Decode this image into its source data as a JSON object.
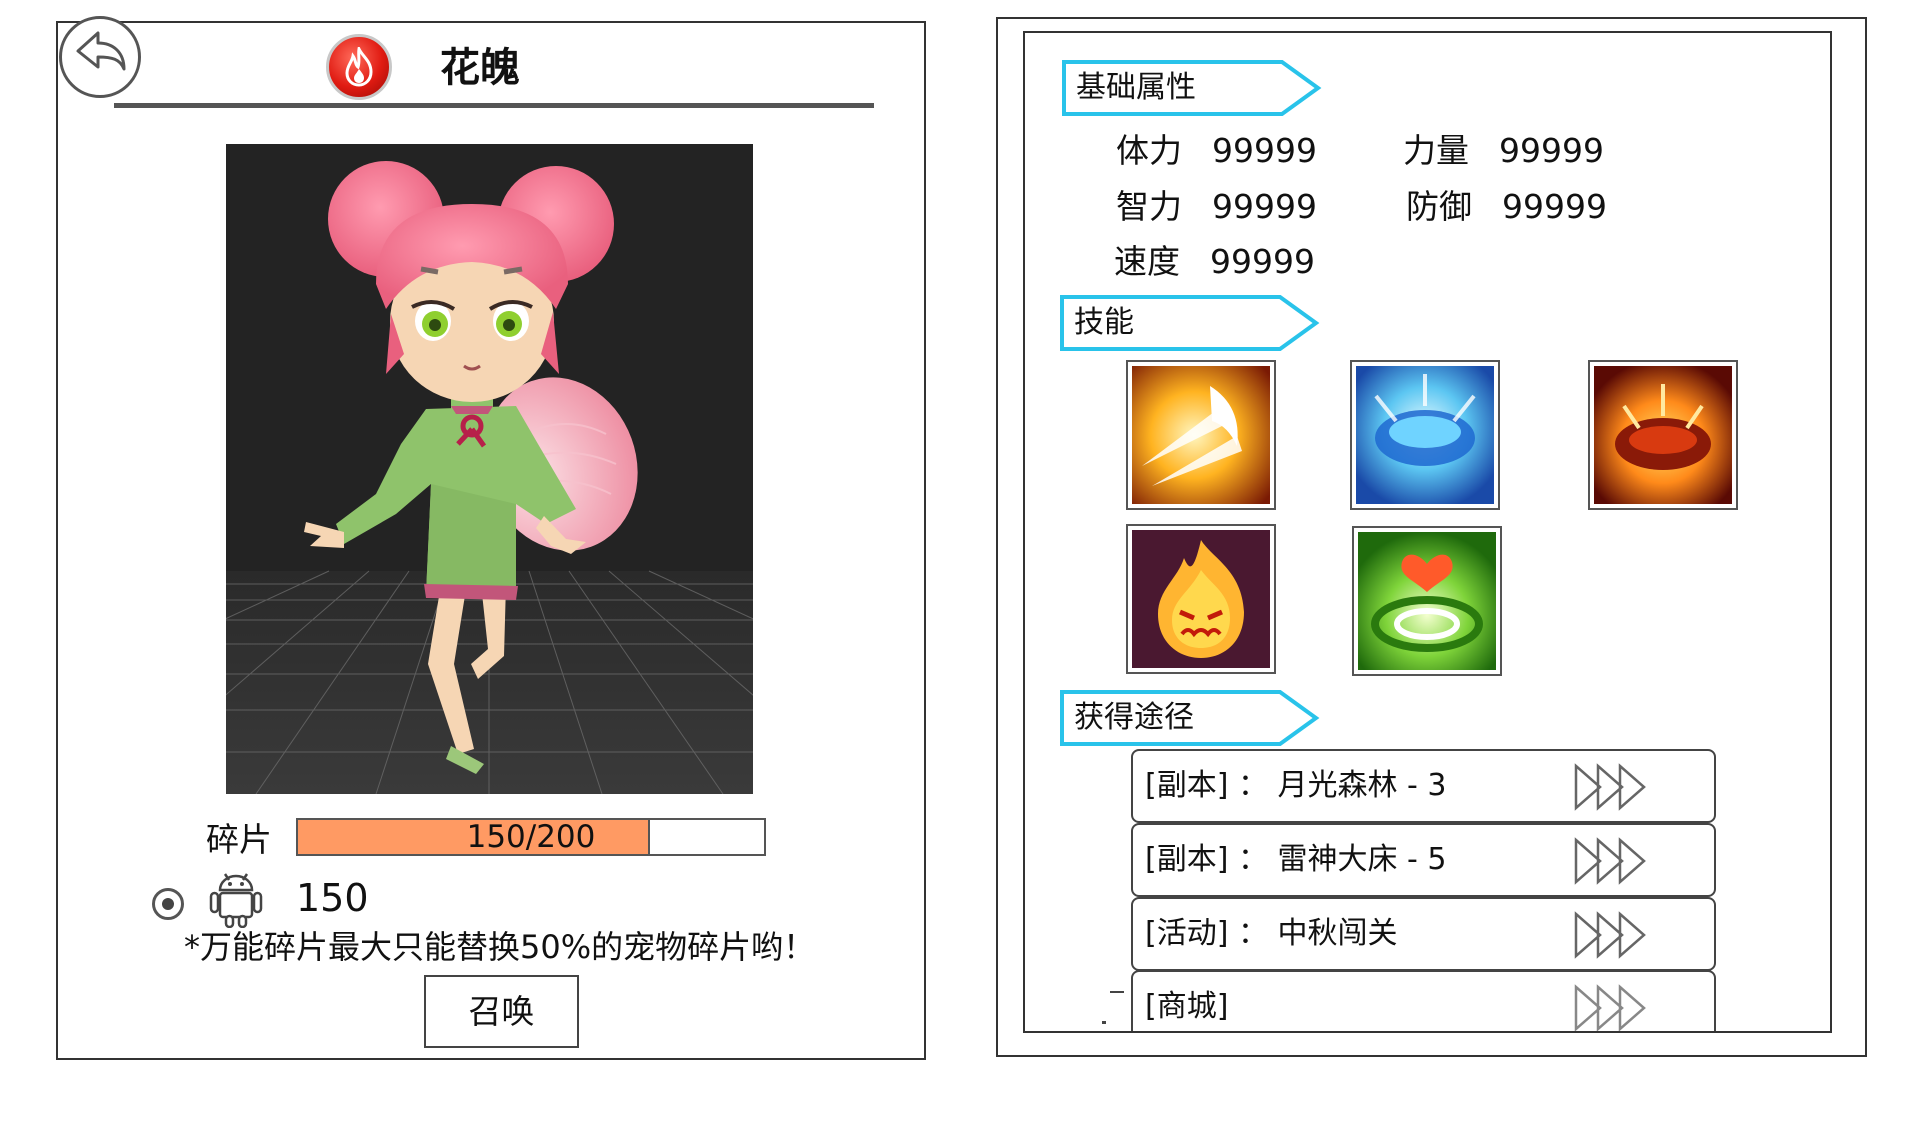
{
  "header": {
    "hero_name": "花魄",
    "back_icon": "back-arrow-icon",
    "element_icon": "fire-icon"
  },
  "shards": {
    "label": "碎片",
    "current": 150,
    "max": 200,
    "text": "150/200",
    "fill_fraction": 0.75
  },
  "universal": {
    "icon": "android-icon",
    "count": "150",
    "note": "*万能碎片最大只能替换50%的宠物碎片哟！"
  },
  "summon_label": "召唤",
  "sections": {
    "attributes": "基础属性",
    "skills": "技能",
    "sources": "获得途径"
  },
  "stats": [
    {
      "label": "体力",
      "value": "99999"
    },
    {
      "label": "力量",
      "value": "99999"
    },
    {
      "label": "智力",
      "value": "99999"
    },
    {
      "label": "防御",
      "value": "99999"
    },
    {
      "label": "速度",
      "value": "99999"
    }
  ],
  "skills": [
    {
      "icon": "claw-slash-skill-icon"
    },
    {
      "icon": "water-blast-skill-icon"
    },
    {
      "icon": "fire-crater-skill-icon"
    },
    {
      "icon": "angry-flame-skill-icon"
    },
    {
      "icon": "heart-ripple-skill-icon"
    }
  ],
  "sources": [
    {
      "text": "[副本] ： 月光森林 - 3"
    },
    {
      "text": "[副本] ： 雷神大床 - 5"
    },
    {
      "text": "[活动] ： 中秋闯关"
    },
    {
      "text": "[商城]"
    }
  ],
  "colors": {
    "section_border": "#29c3ea",
    "shard_fill": "#ff9a63",
    "badge_red": "#e01b12"
  }
}
